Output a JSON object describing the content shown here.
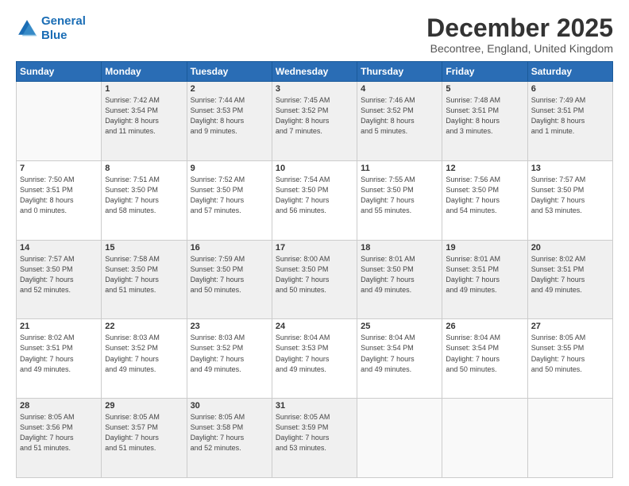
{
  "logo": {
    "line1": "General",
    "line2": "Blue"
  },
  "title": "December 2025",
  "subtitle": "Becontree, England, United Kingdom",
  "days_of_week": [
    "Sunday",
    "Monday",
    "Tuesday",
    "Wednesday",
    "Thursday",
    "Friday",
    "Saturday"
  ],
  "weeks": [
    [
      {
        "day": "",
        "info": ""
      },
      {
        "day": "1",
        "info": "Sunrise: 7:42 AM\nSunset: 3:54 PM\nDaylight: 8 hours\nand 11 minutes."
      },
      {
        "day": "2",
        "info": "Sunrise: 7:44 AM\nSunset: 3:53 PM\nDaylight: 8 hours\nand 9 minutes."
      },
      {
        "day": "3",
        "info": "Sunrise: 7:45 AM\nSunset: 3:52 PM\nDaylight: 8 hours\nand 7 minutes."
      },
      {
        "day": "4",
        "info": "Sunrise: 7:46 AM\nSunset: 3:52 PM\nDaylight: 8 hours\nand 5 minutes."
      },
      {
        "day": "5",
        "info": "Sunrise: 7:48 AM\nSunset: 3:51 PM\nDaylight: 8 hours\nand 3 minutes."
      },
      {
        "day": "6",
        "info": "Sunrise: 7:49 AM\nSunset: 3:51 PM\nDaylight: 8 hours\nand 1 minute."
      }
    ],
    [
      {
        "day": "7",
        "info": "Sunrise: 7:50 AM\nSunset: 3:51 PM\nDaylight: 8 hours\nand 0 minutes."
      },
      {
        "day": "8",
        "info": "Sunrise: 7:51 AM\nSunset: 3:50 PM\nDaylight: 7 hours\nand 58 minutes."
      },
      {
        "day": "9",
        "info": "Sunrise: 7:52 AM\nSunset: 3:50 PM\nDaylight: 7 hours\nand 57 minutes."
      },
      {
        "day": "10",
        "info": "Sunrise: 7:54 AM\nSunset: 3:50 PM\nDaylight: 7 hours\nand 56 minutes."
      },
      {
        "day": "11",
        "info": "Sunrise: 7:55 AM\nSunset: 3:50 PM\nDaylight: 7 hours\nand 55 minutes."
      },
      {
        "day": "12",
        "info": "Sunrise: 7:56 AM\nSunset: 3:50 PM\nDaylight: 7 hours\nand 54 minutes."
      },
      {
        "day": "13",
        "info": "Sunrise: 7:57 AM\nSunset: 3:50 PM\nDaylight: 7 hours\nand 53 minutes."
      }
    ],
    [
      {
        "day": "14",
        "info": "Sunrise: 7:57 AM\nSunset: 3:50 PM\nDaylight: 7 hours\nand 52 minutes."
      },
      {
        "day": "15",
        "info": "Sunrise: 7:58 AM\nSunset: 3:50 PM\nDaylight: 7 hours\nand 51 minutes."
      },
      {
        "day": "16",
        "info": "Sunrise: 7:59 AM\nSunset: 3:50 PM\nDaylight: 7 hours\nand 50 minutes."
      },
      {
        "day": "17",
        "info": "Sunrise: 8:00 AM\nSunset: 3:50 PM\nDaylight: 7 hours\nand 50 minutes."
      },
      {
        "day": "18",
        "info": "Sunrise: 8:01 AM\nSunset: 3:50 PM\nDaylight: 7 hours\nand 49 minutes."
      },
      {
        "day": "19",
        "info": "Sunrise: 8:01 AM\nSunset: 3:51 PM\nDaylight: 7 hours\nand 49 minutes."
      },
      {
        "day": "20",
        "info": "Sunrise: 8:02 AM\nSunset: 3:51 PM\nDaylight: 7 hours\nand 49 minutes."
      }
    ],
    [
      {
        "day": "21",
        "info": "Sunrise: 8:02 AM\nSunset: 3:51 PM\nDaylight: 7 hours\nand 49 minutes."
      },
      {
        "day": "22",
        "info": "Sunrise: 8:03 AM\nSunset: 3:52 PM\nDaylight: 7 hours\nand 49 minutes."
      },
      {
        "day": "23",
        "info": "Sunrise: 8:03 AM\nSunset: 3:52 PM\nDaylight: 7 hours\nand 49 minutes."
      },
      {
        "day": "24",
        "info": "Sunrise: 8:04 AM\nSunset: 3:53 PM\nDaylight: 7 hours\nand 49 minutes."
      },
      {
        "day": "25",
        "info": "Sunrise: 8:04 AM\nSunset: 3:54 PM\nDaylight: 7 hours\nand 49 minutes."
      },
      {
        "day": "26",
        "info": "Sunrise: 8:04 AM\nSunset: 3:54 PM\nDaylight: 7 hours\nand 50 minutes."
      },
      {
        "day": "27",
        "info": "Sunrise: 8:05 AM\nSunset: 3:55 PM\nDaylight: 7 hours\nand 50 minutes."
      }
    ],
    [
      {
        "day": "28",
        "info": "Sunrise: 8:05 AM\nSunset: 3:56 PM\nDaylight: 7 hours\nand 51 minutes."
      },
      {
        "day": "29",
        "info": "Sunrise: 8:05 AM\nSunset: 3:57 PM\nDaylight: 7 hours\nand 51 minutes."
      },
      {
        "day": "30",
        "info": "Sunrise: 8:05 AM\nSunset: 3:58 PM\nDaylight: 7 hours\nand 52 minutes."
      },
      {
        "day": "31",
        "info": "Sunrise: 8:05 AM\nSunset: 3:59 PM\nDaylight: 7 hours\nand 53 minutes."
      },
      {
        "day": "",
        "info": ""
      },
      {
        "day": "",
        "info": ""
      },
      {
        "day": "",
        "info": ""
      }
    ]
  ]
}
